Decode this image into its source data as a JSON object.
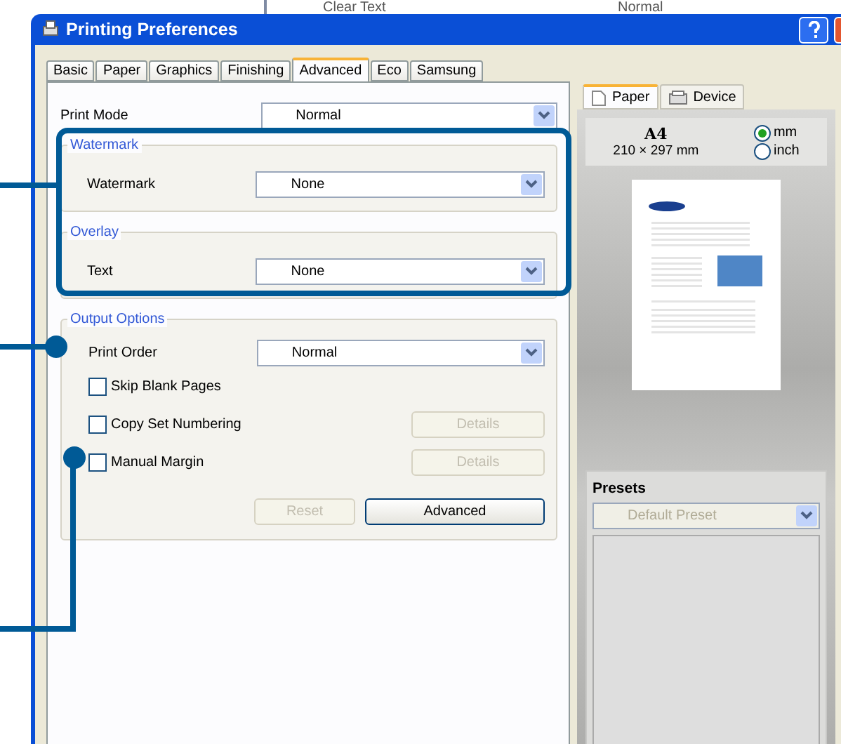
{
  "background_window": {
    "cells": [
      "Clear Text",
      "Normal"
    ]
  },
  "window": {
    "title": "Printing Preferences"
  },
  "tabs": [
    {
      "label": "Basic",
      "selected": false
    },
    {
      "label": "Paper",
      "selected": false
    },
    {
      "label": "Graphics",
      "selected": false
    },
    {
      "label": "Finishing",
      "selected": false
    },
    {
      "label": "Advanced",
      "selected": true
    },
    {
      "label": "Eco",
      "selected": false
    },
    {
      "label": "Samsung",
      "selected": false
    }
  ],
  "print_mode": {
    "label": "Print Mode",
    "value": "Normal"
  },
  "watermark_group": {
    "title": "Watermark",
    "label": "Watermark",
    "value": "None"
  },
  "overlay_group": {
    "title": "Overlay",
    "label": "Text",
    "value": "None"
  },
  "output_options": {
    "title": "Output Options",
    "print_order": {
      "label": "Print Order",
      "value": "Normal"
    },
    "options": [
      {
        "label": "Skip Blank Pages",
        "checked": false
      },
      {
        "label": "Copy Set Numbering",
        "checked": false,
        "details": {
          "label": "Details",
          "disabled": true
        }
      },
      {
        "label": "Manual Margin",
        "checked": false,
        "details": {
          "label": "Details",
          "disabled": true
        }
      }
    ],
    "buttons": [
      {
        "label": "Reset",
        "disabled": true
      },
      {
        "label": "Advanced",
        "disabled": false
      }
    ]
  },
  "preview_tabs": [
    {
      "label": "Paper",
      "selected": true
    },
    {
      "label": "Device",
      "selected": false
    }
  ],
  "paper": {
    "size": "A4",
    "dimensions": "210 × 297 mm",
    "units": [
      {
        "label": "mm",
        "selected": true
      },
      {
        "label": "inch",
        "selected": false
      }
    ]
  },
  "presets": {
    "title": "Presets",
    "value": "Default Preset",
    "disabled": true
  }
}
